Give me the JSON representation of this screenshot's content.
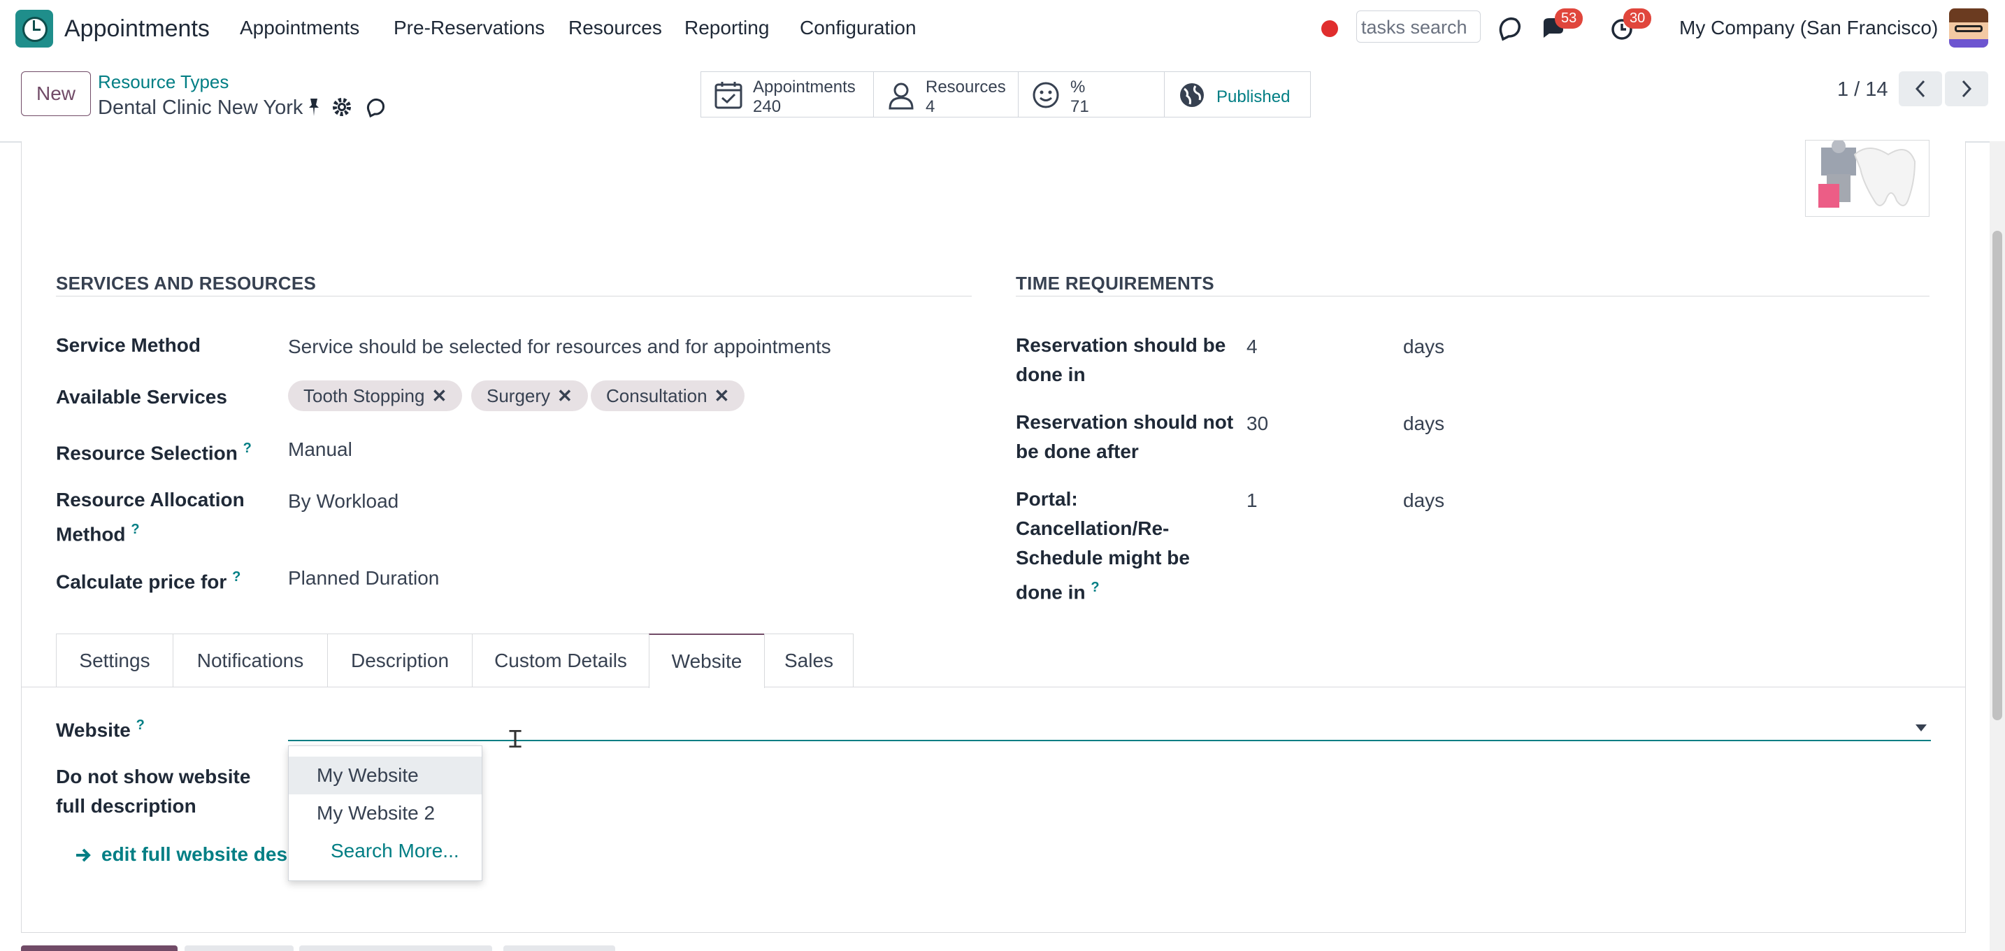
{
  "topnav": {
    "app_name": "Appointments",
    "menu": [
      "Appointments",
      "Pre-Reservations",
      "Resources",
      "Reporting",
      "Configuration"
    ],
    "search_placeholder": "tasks search",
    "messages_count": "53",
    "activities_count": "30",
    "company": "My Company (San Francisco)"
  },
  "control": {
    "new_label": "New",
    "breadcrumb": "Resource Types",
    "record_name": "Dental Clinic New York",
    "stats": {
      "appointments_label": "Appointments",
      "appointments_value": "240",
      "resources_label": "Resources",
      "resources_value": "4",
      "rating_label": "%",
      "rating_value": "71",
      "published_label": "Published"
    },
    "pager": "1 / 14"
  },
  "services": {
    "title": "SERVICES AND RESOURCES",
    "service_method_label": "Service Method",
    "service_method_value": "Service should be selected for resources and for appointments",
    "available_services_label": "Available Services",
    "tags": [
      "Tooth Stopping",
      "Surgery",
      "Consultation"
    ],
    "tag_remove": "✕",
    "resource_selection_label": "Resource Selection",
    "resource_selection_value": "Manual",
    "allocation_label_1": "Resource Allocation",
    "allocation_label_2": "Method",
    "allocation_value": "By Workload",
    "price_label": "Calculate price for",
    "price_value": "Planned Duration",
    "help": "?"
  },
  "time": {
    "title": "TIME REQUIREMENTS",
    "r1_label_1": "Reservation should be",
    "r1_label_2": "done in",
    "r1_value": "4",
    "r1_unit": "days",
    "r2_label_1": "Reservation should not",
    "r2_label_2": "be done after",
    "r2_value": "30",
    "r2_unit": "days",
    "r3_label_1": "Portal:",
    "r3_label_2": "Cancellation/Re-",
    "r3_label_3": "Schedule might be",
    "r3_label_4": "done in",
    "r3_value": "1",
    "r3_unit": "days"
  },
  "tabs": [
    "Settings",
    "Notifications",
    "Description",
    "Custom Details",
    "Website",
    "Sales"
  ],
  "website": {
    "website_label": "Website",
    "options": [
      "My Website",
      "My Website 2"
    ],
    "search_more": "Search More...",
    "no_desc_label_1": "Do not show website",
    "no_desc_label_2": "full description",
    "edit_link": "edit full website desc"
  },
  "colors": {
    "brand": "#714b67",
    "accent": "#017e84",
    "badge": "#e0463c"
  }
}
